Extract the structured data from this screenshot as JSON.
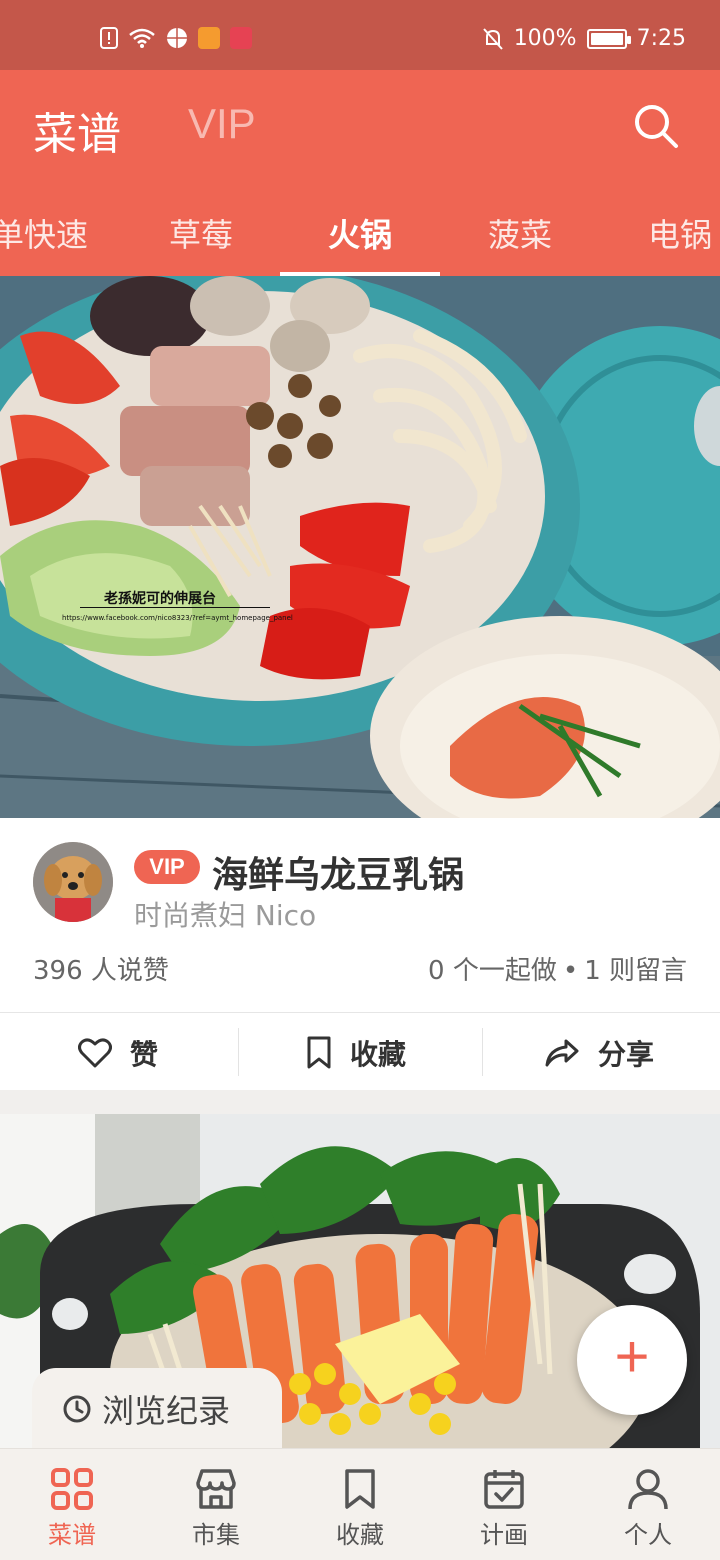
{
  "status_bar": {
    "battery": "100%",
    "time": "7:25",
    "battery_level": 1.0
  },
  "header": {
    "title": "菜谱",
    "vip_tab": "VIP",
    "tabs": [
      {
        "label": "单快速",
        "active": false
      },
      {
        "label": "草莓",
        "active": false
      },
      {
        "label": "火锅",
        "active": true
      },
      {
        "label": "菠菜",
        "active": false
      },
      {
        "label": "电锅",
        "active": false
      }
    ]
  },
  "photo1": {
    "watermark_text": "老孫妮可的伸展台",
    "watermark_url": "https://www.facebook.com/nico8323/?ref=aymt_homepage_panel"
  },
  "card": {
    "vip_badge": "VIP",
    "title": "海鲜乌龙豆乳锅",
    "author": "时尚煮妇 Nico",
    "likes": "396 人说赞",
    "cook_count": "0 个一起做",
    "separator": "•",
    "comments": "1 则留言",
    "actions": {
      "like": "赞",
      "collect": "收藏",
      "share": "分享"
    }
  },
  "fab": {
    "label": "+"
  },
  "history": {
    "label": "浏览纪录"
  },
  "bottom_nav": [
    {
      "label": "菜谱",
      "icon": "grid-icon",
      "active": true
    },
    {
      "label": "市集",
      "icon": "store-icon",
      "active": false
    },
    {
      "label": "收藏",
      "icon": "bookmark-icon",
      "active": false
    },
    {
      "label": "计画",
      "icon": "calendar-check-icon",
      "active": false
    },
    {
      "label": "个人",
      "icon": "person-icon",
      "active": false
    }
  ],
  "colors": {
    "status_bar": "#c4574a",
    "header": "#ef6553",
    "accent": "#ef6553",
    "nav_bg": "#f4f1ed"
  }
}
